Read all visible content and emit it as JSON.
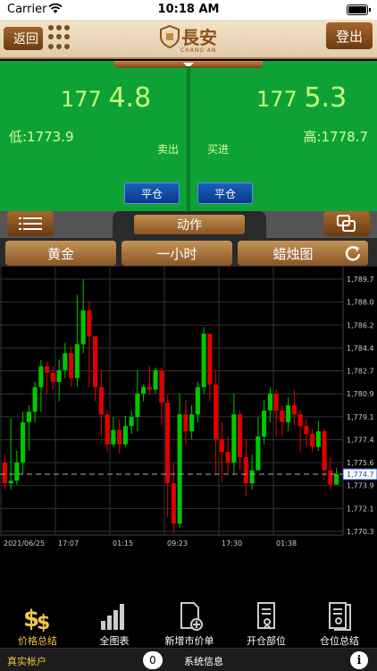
{
  "status_bar": {
    "carrier": "Carrier",
    "time": "10:18 AM"
  },
  "header": {
    "back_label": "返回",
    "logo_text": "長安",
    "logo_sub": "CHANG AN",
    "login_label": "登出"
  },
  "quote": {
    "sell_price_prefix": "177",
    "sell_price_main": "4.8",
    "buy_price_prefix": "177",
    "buy_price_main": "5.3",
    "low": "低:1773.9",
    "high": "高:1778.7",
    "sell_label": "卖出",
    "buy_label": "买进",
    "close_left_label": "平仓",
    "close_right_label": "平仓"
  },
  "actionbar": {
    "action_label": "动作"
  },
  "selectors": {
    "symbol": "黄金",
    "period": "一小时",
    "chart_type": "蜡烛图"
  },
  "chart_data": {
    "type": "candlestick",
    "ylim": [
      1770.3,
      1789.7
    ],
    "y_ticks": [
      "1,789.7",
      "1,788.0",
      "1,786.2",
      "1,784.4",
      "1,782.7",
      "1,780.9",
      "1,779.1",
      "1,777.4",
      "1,775.6",
      "1,773.9",
      "1,772.1",
      "1,770.3"
    ],
    "x_ticks": [
      "2021/06/25",
      "17:07",
      "01:15",
      "09:23",
      "17:30",
      "01:38"
    ],
    "current_price": "1,774.7",
    "current_value": 1774.7,
    "colors": {
      "up": "#00c800",
      "down": "#e00000",
      "current_line": "#aaaaaa"
    },
    "candles": [
      [
        1775.6,
        1774.0,
        1776.2,
        1773.5
      ],
      [
        1774.0,
        1774.2,
        1779.0,
        1773.5
      ],
      [
        1774.2,
        1775.6,
        1776.5,
        1773.9
      ],
      [
        1775.6,
        1778.7,
        1779.5,
        1774.7
      ],
      [
        1778.7,
        1779.5,
        1780.0,
        1776.5
      ],
      [
        1779.5,
        1781.4,
        1781.8,
        1778.7
      ],
      [
        1781.4,
        1783.0,
        1783.5,
        1779.5
      ],
      [
        1783.0,
        1782.5,
        1783.4,
        1780.9
      ],
      [
        1782.5,
        1781.8,
        1783.0,
        1781.2
      ],
      [
        1781.8,
        1782.7,
        1783.5,
        1780.3
      ],
      [
        1782.7,
        1784.0,
        1784.8,
        1782.1
      ],
      [
        1784.0,
        1782.1,
        1784.5,
        1781.4
      ],
      [
        1782.1,
        1784.7,
        1788.5,
        1781.4
      ],
      [
        1784.7,
        1787.3,
        1789.7,
        1784.0
      ],
      [
        1787.3,
        1785.3,
        1788.0,
        1781.4
      ],
      [
        1785.3,
        1781.4,
        1785.3,
        1780.3
      ],
      [
        1781.4,
        1779.3,
        1782.7,
        1777.6
      ],
      [
        1779.3,
        1777.0,
        1779.6,
        1776.4
      ],
      [
        1777.0,
        1778.1,
        1779.1,
        1776.8
      ],
      [
        1778.1,
        1777.0,
        1778.9,
        1776.3
      ],
      [
        1777.0,
        1778.4,
        1779.2,
        1776.8
      ],
      [
        1778.4,
        1779.1,
        1779.6,
        1777.8
      ],
      [
        1779.1,
        1780.9,
        1782.7,
        1778.0
      ],
      [
        1780.9,
        1781.4,
        1781.6,
        1780.3
      ],
      [
        1781.4,
        1781.2,
        1783.0,
        1780.8
      ],
      [
        1781.2,
        1782.7,
        1782.9,
        1780.9
      ],
      [
        1782.7,
        1780.2,
        1782.9,
        1778.5
      ],
      [
        1780.2,
        1774.0,
        1780.8,
        1771.4
      ],
      [
        1774.0,
        1770.9,
        1775.6,
        1770.1
      ],
      [
        1770.9,
        1779.3,
        1780.9,
        1770.6
      ],
      [
        1779.3,
        1778.0,
        1780.4,
        1777.0
      ],
      [
        1778.0,
        1779.3,
        1780.0,
        1777.4
      ],
      [
        1779.3,
        1781.4,
        1781.8,
        1778.7
      ],
      [
        1781.4,
        1785.5,
        1786.0,
        1780.9
      ],
      [
        1785.5,
        1781.6,
        1785.5,
        1780.3
      ],
      [
        1781.6,
        1777.4,
        1782.7,
        1774.7
      ],
      [
        1777.4,
        1776.4,
        1778.7,
        1774.1
      ],
      [
        1776.4,
        1775.6,
        1777.6,
        1774.8
      ],
      [
        1775.6,
        1779.3,
        1780.9,
        1774.7
      ],
      [
        1779.3,
        1776.0,
        1779.6,
        1775.0
      ],
      [
        1776.0,
        1774.0,
        1777.4,
        1773.0
      ],
      [
        1774.0,
        1775.0,
        1776.2,
        1773.5
      ],
      [
        1775.0,
        1777.6,
        1779.1,
        1775.0
      ],
      [
        1777.6,
        1779.6,
        1780.4,
        1777.0
      ],
      [
        1779.6,
        1780.9,
        1781.4,
        1778.7
      ],
      [
        1780.9,
        1779.6,
        1781.2,
        1777.6
      ],
      [
        1779.6,
        1778.7,
        1780.0,
        1777.6
      ],
      [
        1778.7,
        1780.0,
        1780.6,
        1778.0
      ],
      [
        1780.0,
        1779.3,
        1781.2,
        1778.5
      ],
      [
        1779.3,
        1778.4,
        1779.6,
        1776.4
      ],
      [
        1778.4,
        1777.8,
        1779.0,
        1776.8
      ],
      [
        1777.8,
        1776.8,
        1778.2,
        1776.4
      ],
      [
        1776.8,
        1778.0,
        1778.8,
        1776.5
      ],
      [
        1778.0,
        1775.0,
        1778.2,
        1774.2
      ],
      [
        1775.0,
        1773.9,
        1776.0,
        1773.5
      ],
      [
        1773.9,
        1774.7,
        1775.2,
        1773.9
      ]
    ]
  },
  "tabs": [
    {
      "label": "价格总结",
      "icon": "dollar-icon",
      "active": true
    },
    {
      "label": "全图表",
      "icon": "bar-chart-icon",
      "active": false
    },
    {
      "label": "新增市价单",
      "icon": "new-order-icon",
      "active": false
    },
    {
      "label": "开仓部位",
      "icon": "open-position-icon",
      "active": false
    },
    {
      "label": "仓位总结",
      "icon": "position-summary-icon",
      "active": false
    }
  ],
  "bottom_bar": {
    "account": "真实帐户",
    "message_count": "0",
    "system_info": "系统信息",
    "info_icon": "i"
  }
}
